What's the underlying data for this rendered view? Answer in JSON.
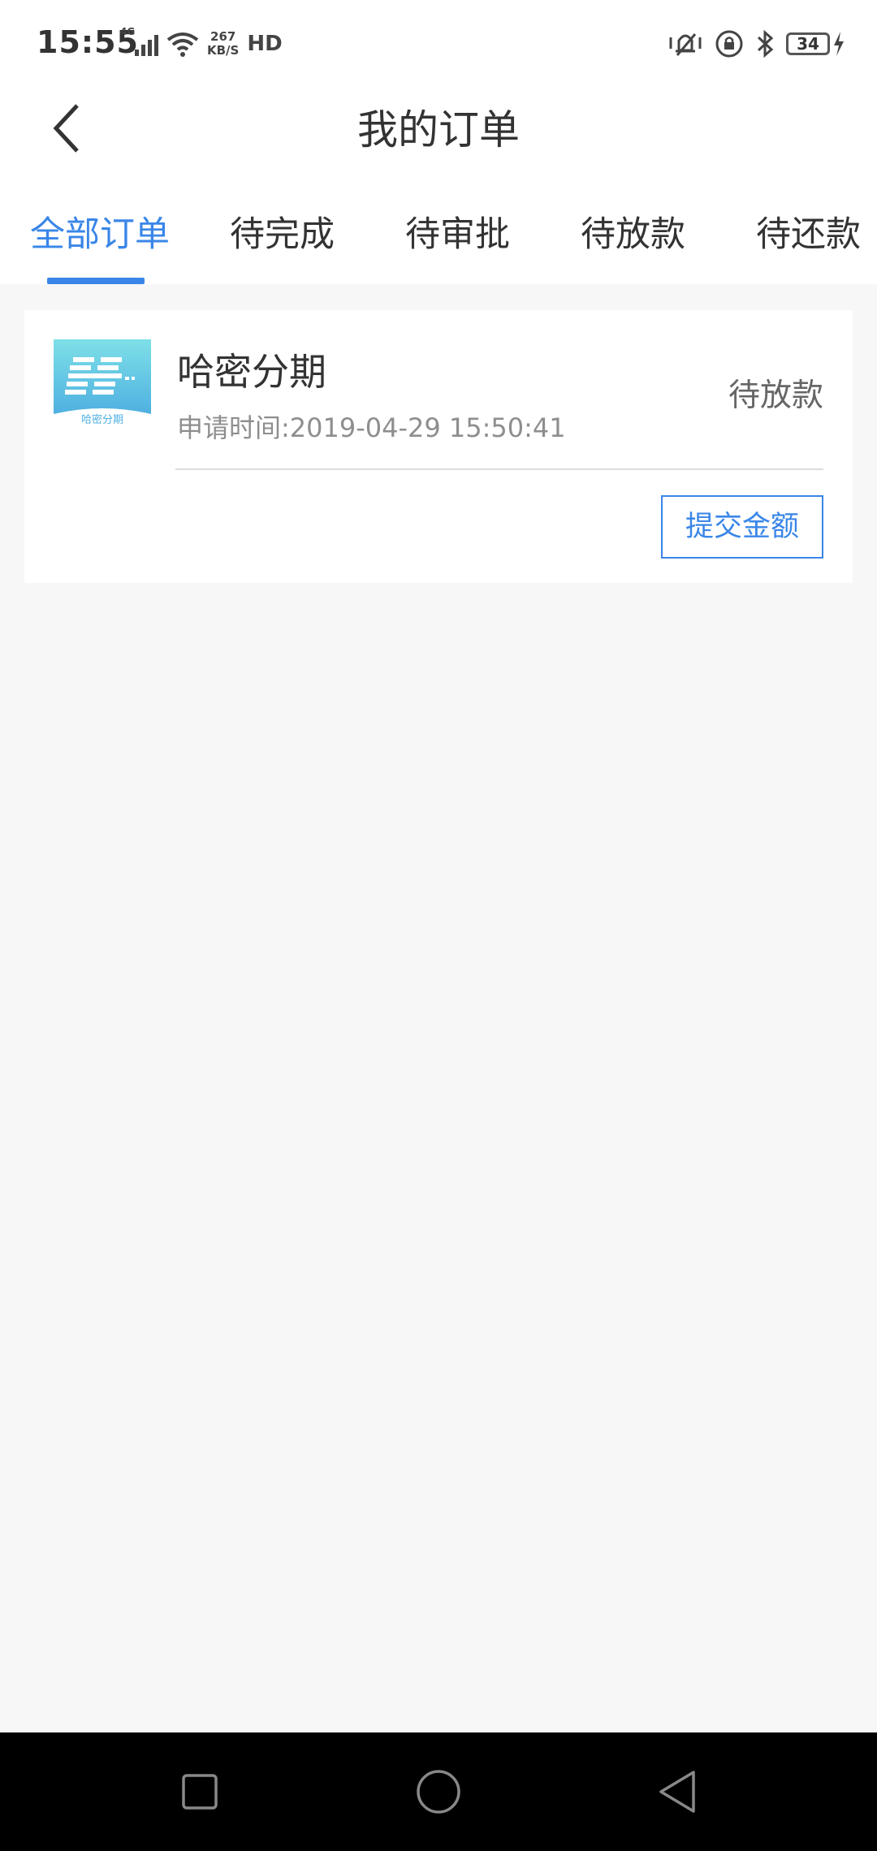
{
  "status_bar": {
    "time": "15:55",
    "network_type": "4G",
    "speed_value": "267",
    "speed_unit": "KB/S",
    "hd_label": "HD",
    "battery_level": "34"
  },
  "header": {
    "title": "我的订单",
    "back_icon": "chevron-left-icon"
  },
  "tabs": [
    {
      "label": "全部订单",
      "active": true
    },
    {
      "label": "待完成",
      "active": false
    },
    {
      "label": "待审批",
      "active": false
    },
    {
      "label": "待放款",
      "active": false
    },
    {
      "label": "待还款",
      "active": false
    }
  ],
  "order": {
    "logo_text": "哈密分期",
    "name": "哈密分期",
    "apply_time": "申请时间:2019-04-29 15:50:41",
    "status": "待放款",
    "submit_label": "提交金额"
  },
  "colors": {
    "accent": "#3a86e8",
    "background": "#f7f7f7",
    "logo_teal": "#6dd3e3"
  },
  "nav_bar": {
    "recent_icon": "square-icon",
    "home_icon": "circle-icon",
    "back_icon": "triangle-back-icon"
  }
}
